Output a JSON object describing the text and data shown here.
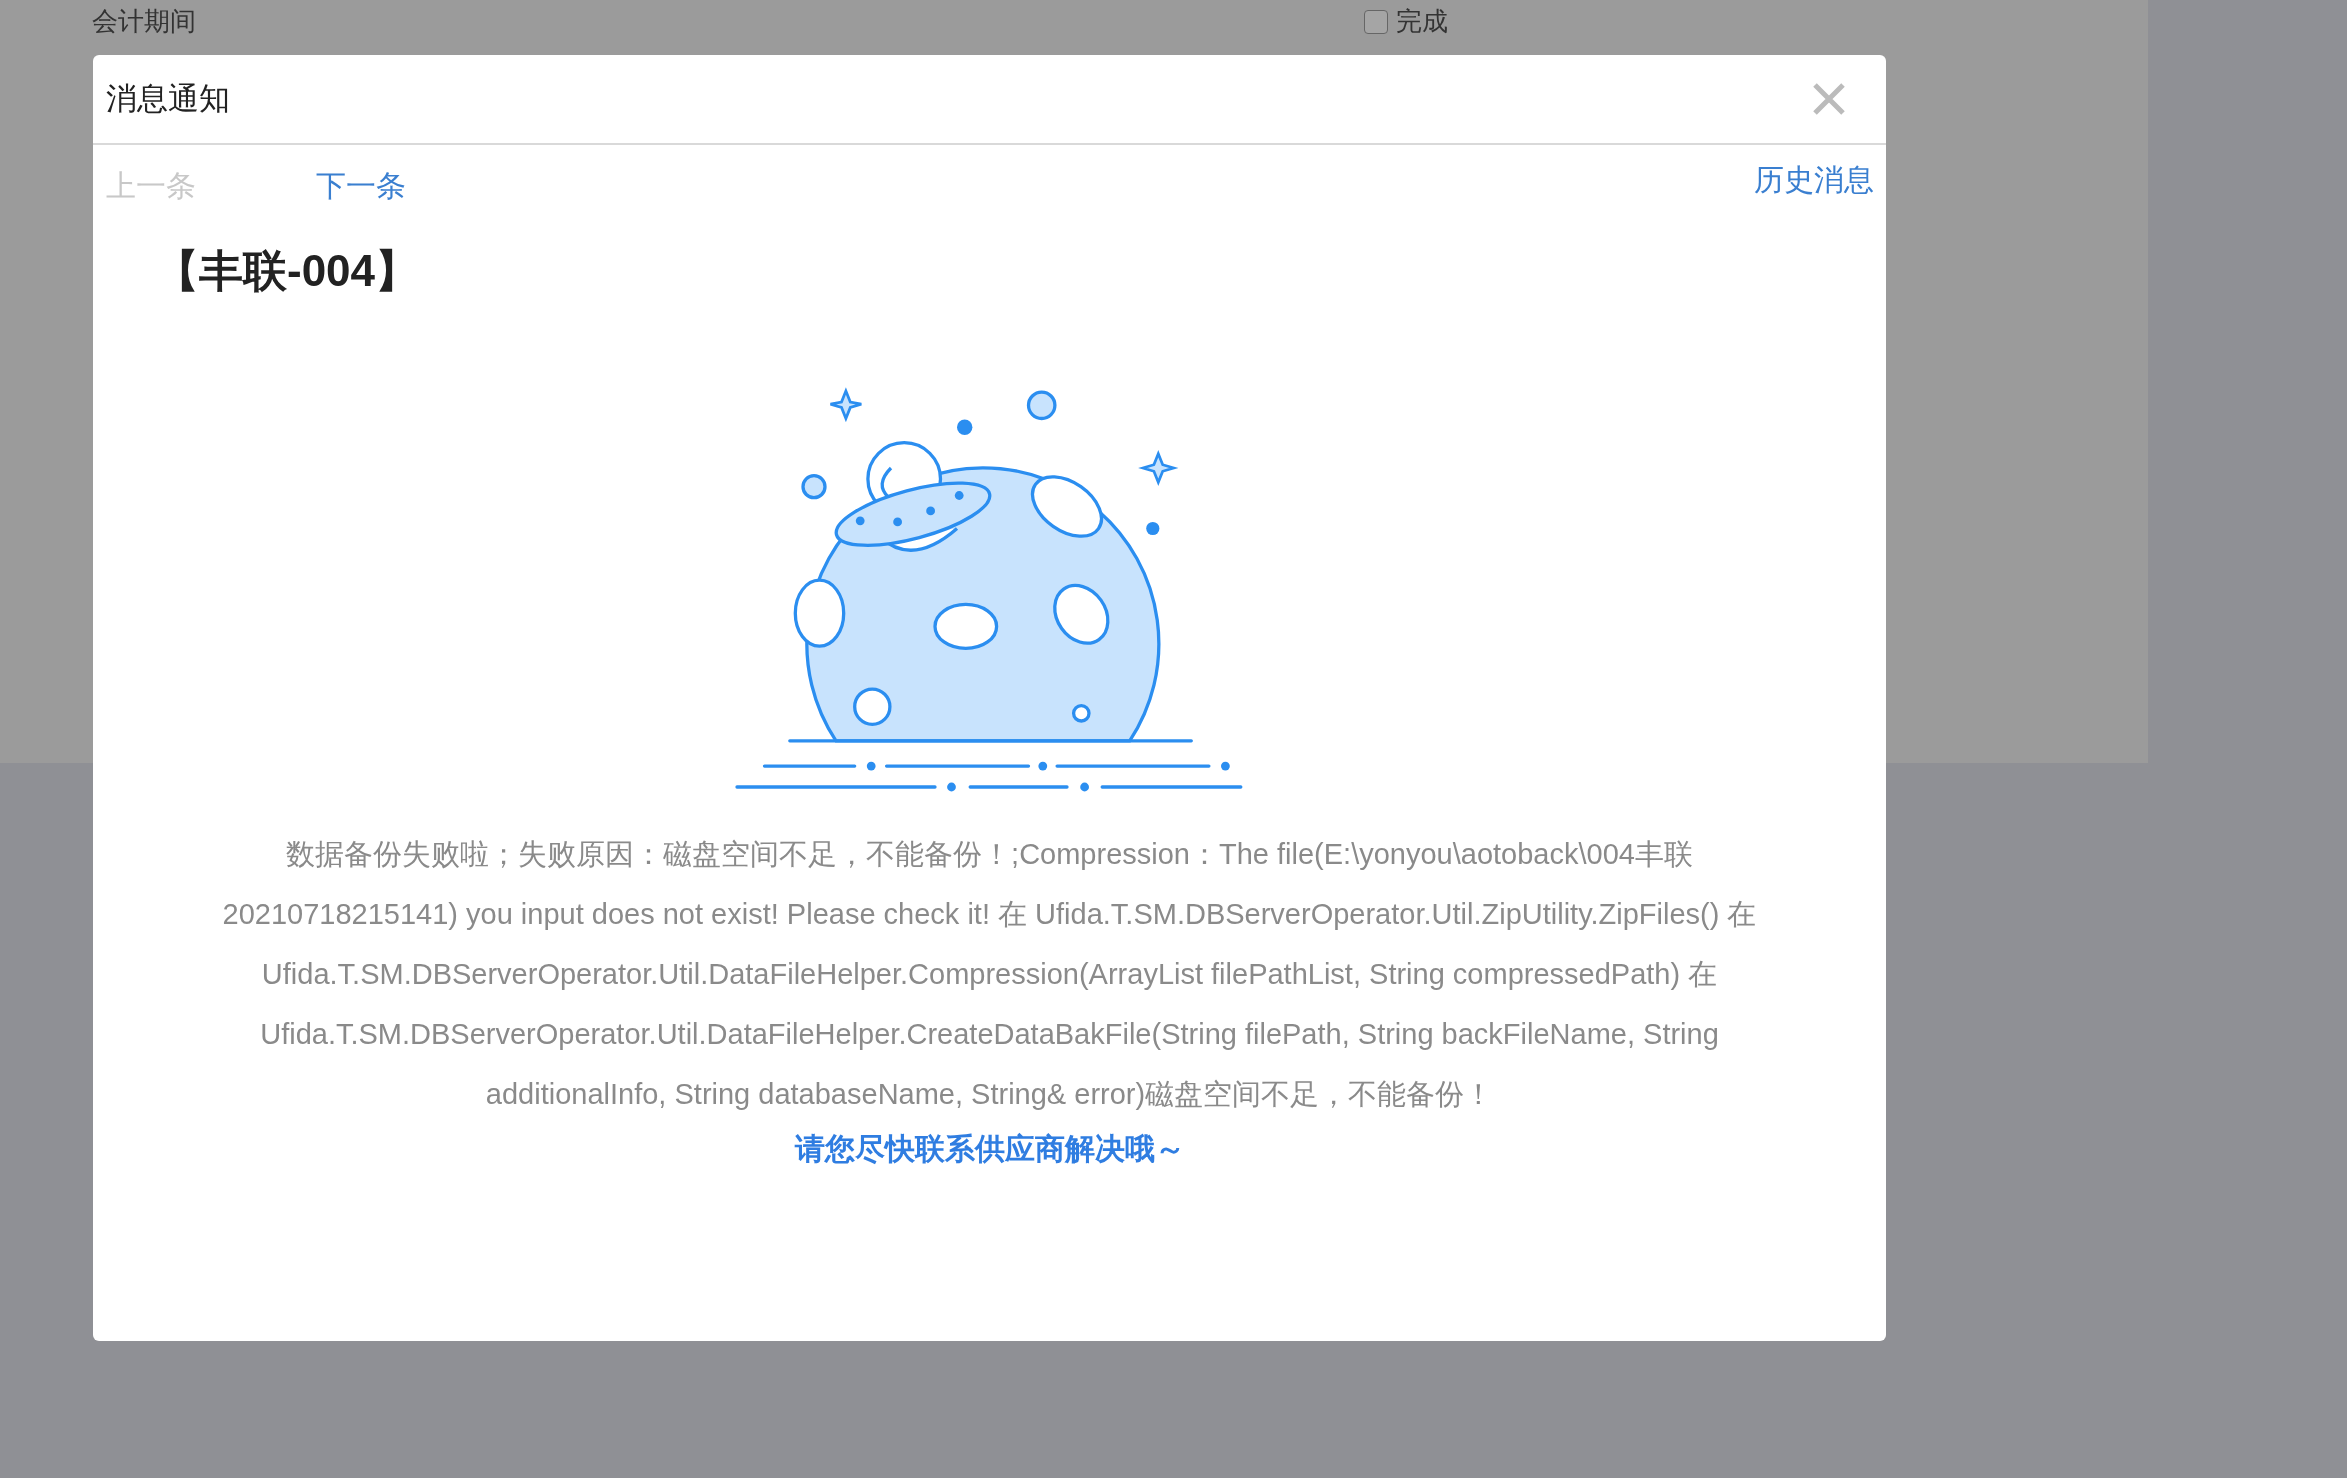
{
  "background": {
    "field_label": "会计期间",
    "checkbox": {
      "label": "完成",
      "checked": false
    }
  },
  "dialog": {
    "title": "消息通知",
    "nav": [
      {
        "label": "上一条",
        "disabled": true
      },
      {
        "label": "下一条",
        "disabled": false
      }
    ],
    "history_link": "历史消息",
    "heading": "【丰联-004】",
    "message": "数据备份失败啦；失败原因：磁盘空间不足，不能备份！;Compression：The file(E:\\yonyou\\aotoback\\004丰联20210718215141) you input does not exist! Please check it! 在 Ufida.T.SM.DBServerOperator.Util.ZipUtility.ZipFiles() 在 Ufida.T.SM.DBServerOperator.Util.DataFileHelper.Compression(ArrayList filePathList, String compressedPath) 在 Ufida.T.SM.DBServerOperator.Util.DataFileHelper.CreateDataBakFile(String filePath, String backFileName, String additionalInfo, String databaseName, String& error)磁盘空间不足，不能备份！",
    "hint": "请您尽快联系供应商解决哦～"
  }
}
